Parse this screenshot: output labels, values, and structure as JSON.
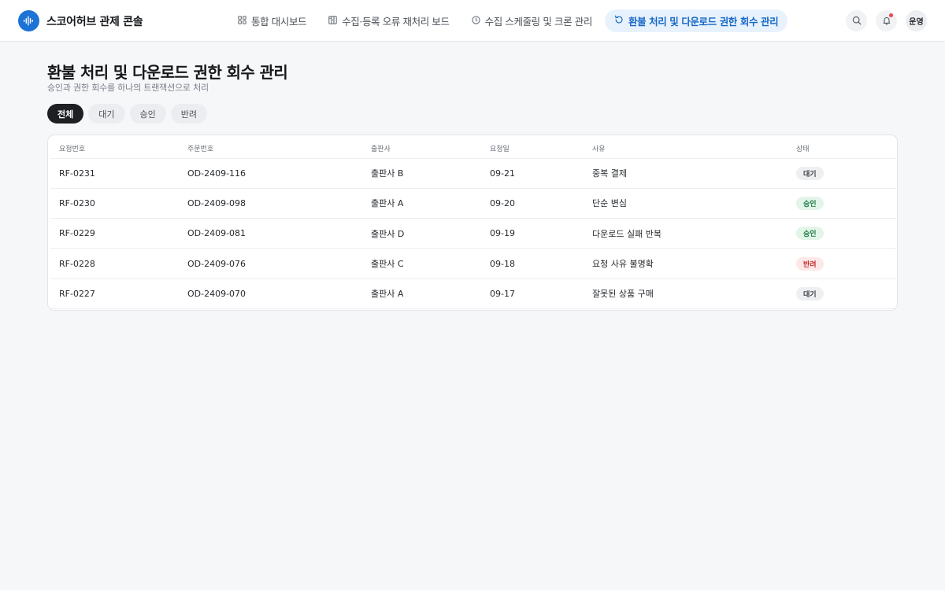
{
  "app": {
    "title": "스코어허브 관제 콘솔",
    "accent_color": "#1d72d6",
    "logo_icon": "waveform-icon"
  },
  "nav": {
    "items": [
      {
        "label": "통합 대시보드",
        "icon": "grid-icon",
        "active": false
      },
      {
        "label": "수집·등록 오류 재처리 보드",
        "icon": "kanban-icon",
        "active": false
      },
      {
        "label": "수집 스케줄링 및 크론 관리",
        "icon": "clock-icon",
        "active": false
      },
      {
        "label": "환불 처리 및 다운로드 권한 회수 관리",
        "icon": "refresh-icon",
        "active": true
      }
    ]
  },
  "actions": {
    "search_icon": "search-icon",
    "bell_icon": "bell-icon",
    "avatar_label": "운영"
  },
  "page": {
    "title": "환불 처리 및 다운로드 권한 회수 관리",
    "subtitle": "승인과 권한 회수를 하나의 트랜잭션으로 처리"
  },
  "filters": [
    {
      "label": "전체",
      "active": true
    },
    {
      "label": "대기",
      "active": false
    },
    {
      "label": "승인",
      "active": false
    },
    {
      "label": "반려",
      "active": false
    }
  ],
  "table": {
    "columns": [
      "요청번호",
      "주문번호",
      "출판사",
      "요청일",
      "사유",
      "상태"
    ],
    "rows": [
      {
        "request_id": "RF-0231",
        "order_id": "OD-2409-116",
        "publisher": "출판사 B",
        "date": "09-21",
        "reason": "중복 결제",
        "status": "대기"
      },
      {
        "request_id": "RF-0230",
        "order_id": "OD-2409-098",
        "publisher": "출판사 A",
        "date": "09-20",
        "reason": "단순 변심",
        "status": "승인"
      },
      {
        "request_id": "RF-0229",
        "order_id": "OD-2409-081",
        "publisher": "출판사 D",
        "date": "09-19",
        "reason": "다운로드 실패 반복",
        "status": "승인"
      },
      {
        "request_id": "RF-0228",
        "order_id": "OD-2409-076",
        "publisher": "출판사 C",
        "date": "09-18",
        "reason": "요청 사유 불명확",
        "status": "반려"
      },
      {
        "request_id": "RF-0227",
        "order_id": "OD-2409-070",
        "publisher": "출판사 A",
        "date": "09-17",
        "reason": "잘못된 상품 구매",
        "status": "대기"
      }
    ]
  },
  "status_colors": {
    "대기": {
      "bg": "#eeeff1",
      "fg": "#3d4147"
    },
    "승인": {
      "bg": "#e3f5e9",
      "fg": "#1e7a45"
    },
    "반려": {
      "bg": "#fde8e8",
      "fg": "#c4302b"
    }
  }
}
